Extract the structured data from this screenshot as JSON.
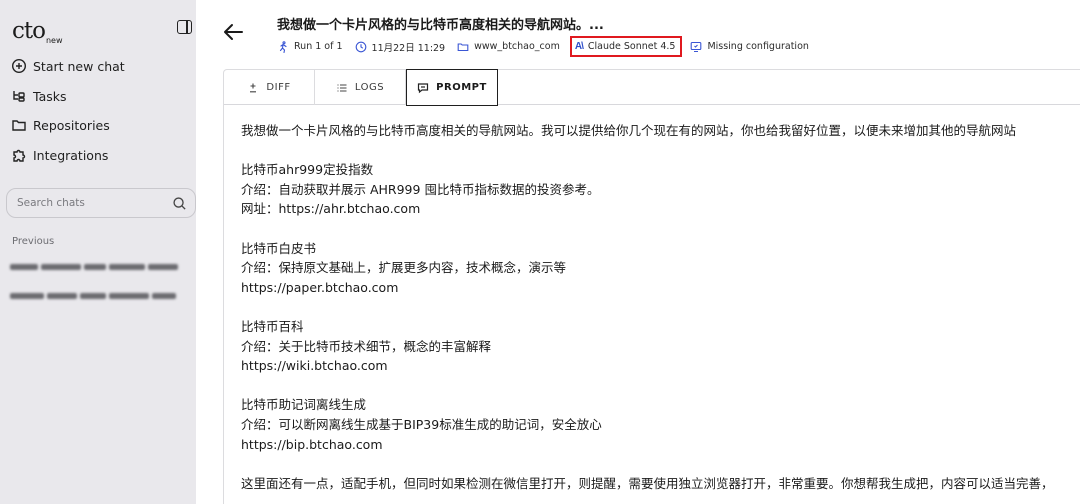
{
  "sidebar": {
    "logo": "cto",
    "logo_suffix": "new",
    "nav": [
      {
        "label": "Start new chat",
        "icon": "plus-circle-icon"
      },
      {
        "label": "Tasks",
        "icon": "tasks-icon"
      },
      {
        "label": "Repositories",
        "icon": "folder-icon"
      },
      {
        "label": "Integrations",
        "icon": "puzzle-icon"
      }
    ],
    "search_placeholder": "Search chats",
    "previous_label": "Previous"
  },
  "header": {
    "title": "我想做一个卡片风格的与比特币高度相关的导航网站。...",
    "run": "Run 1 of 1",
    "date": "11月22日 11:29",
    "repo": "www_btchao_com",
    "model_logo": "A\\",
    "model": "Claude Sonnet 4.5",
    "config": "Missing configuration"
  },
  "tabs": [
    {
      "label": "DIFF",
      "icon": "plus-minus-icon"
    },
    {
      "label": "LOGS",
      "icon": "list-icon"
    },
    {
      "label": "PROMPT",
      "icon": "chat-bubble-icon",
      "active": true
    }
  ],
  "prompt": {
    "intro": "我想做一个卡片风格的与比特币高度相关的导航网站。我可以提供给你几个现在有的网站，你也给我留好位置，以便未来增加其他的导航网站",
    "sites": [
      {
        "name": "比特币ahr999定投指数",
        "desc": "介绍：自动获取并展示 AHR999 囤比特币指标数据的投资参考。",
        "url": "网址：https://ahr.btchao.com"
      },
      {
        "name": "比特币白皮书",
        "desc": "介绍：保持原文基础上，扩展更多内容，技术概念，演示等",
        "url": "https://paper.btchao.com"
      },
      {
        "name": "比特币百科",
        "desc": "介绍：关于比特币技术细节，概念的丰富解释",
        "url": "https://wiki.btchao.com"
      },
      {
        "name": "比特币助记词离线生成",
        "desc": "介绍：可以断网离线生成基于BIP39标准生成的助记词，安全放心",
        "url": "https://bip.btchao.com"
      }
    ],
    "outro": "这里面还有一点，适配手机，但同时如果检测在微信里打开，则提醒，需要使用独立浏览器打开，非常重要。你想帮我生成把，内容可以适当完善，"
  },
  "colors": {
    "sidebar_bg": "#e9e8ec",
    "highlight_border": "#e0191f",
    "model_logo": "#2f4fc9"
  }
}
